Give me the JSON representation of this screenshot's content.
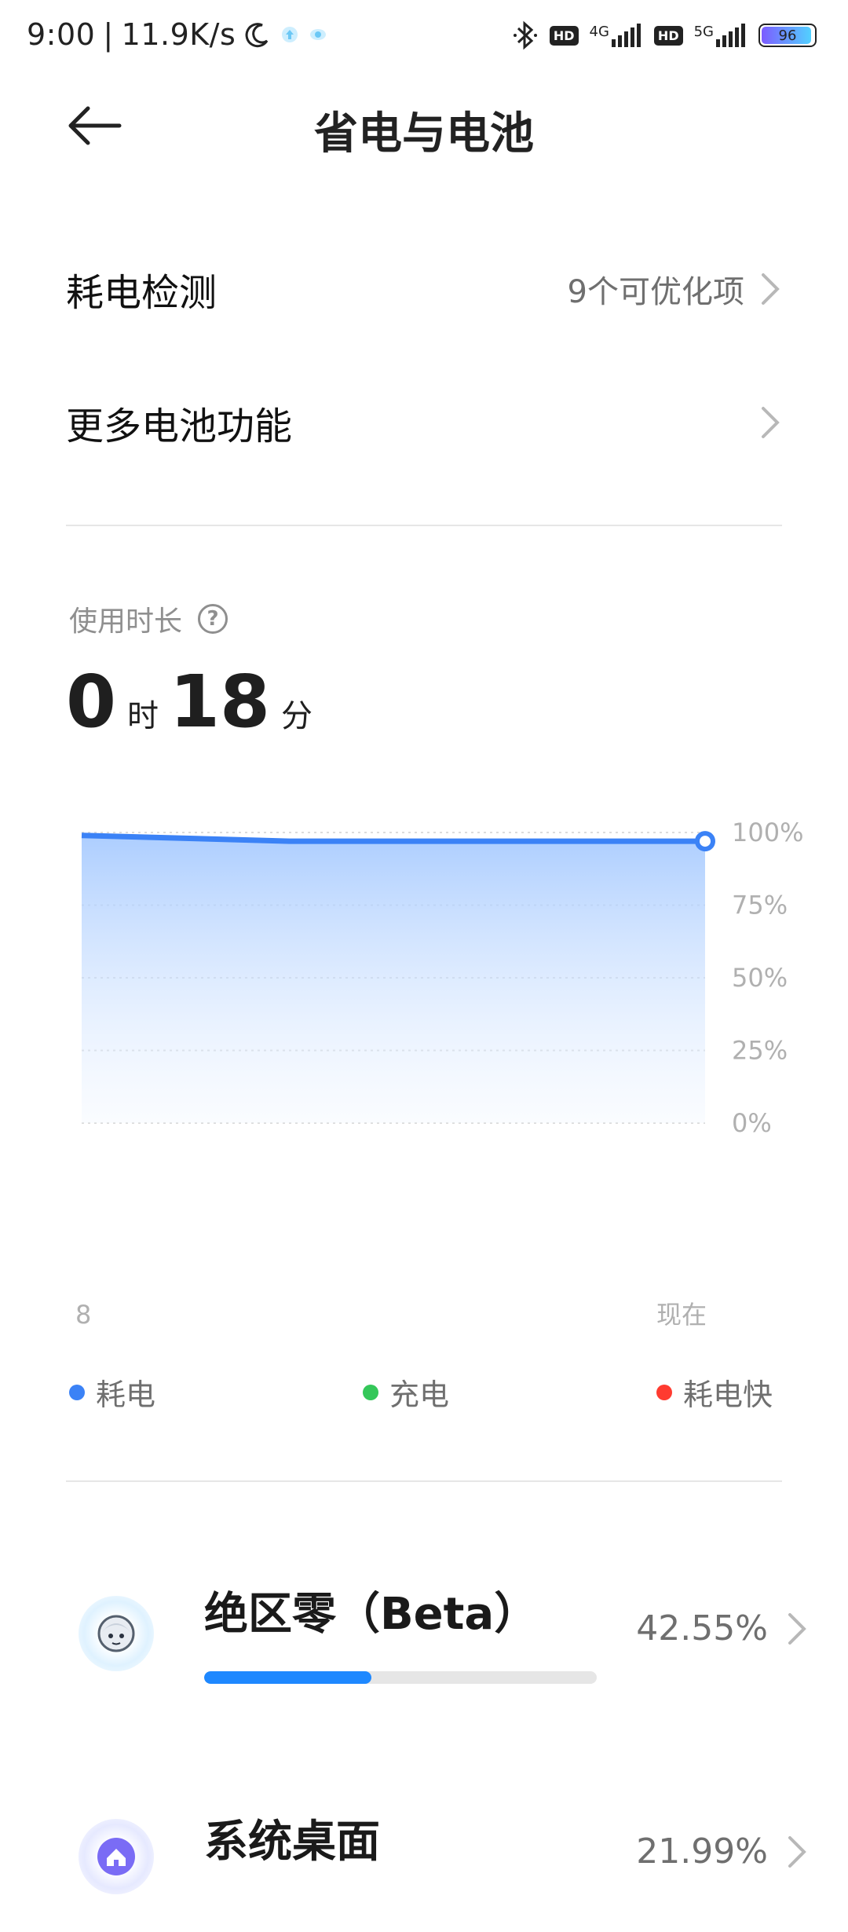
{
  "status_bar": {
    "time": "9:00",
    "net_speed": "11.9K/s",
    "hd1": "HD",
    "net1": "4G",
    "hd2": "HD",
    "net2": "5G",
    "battery": "96",
    "battery_level": 0.96
  },
  "header": {
    "title": "省电与电池"
  },
  "rows": [
    {
      "label": "耗电检测",
      "value": "9个可优化项"
    },
    {
      "label": "更多电池功能",
      "value": ""
    }
  ],
  "usage": {
    "label": "使用时长",
    "hours": "0",
    "hours_unit": "时",
    "minutes": "18",
    "minutes_unit": "分"
  },
  "chart_data": {
    "type": "area",
    "x_start_label": "8",
    "x_end_label": "现在",
    "y_ticks": [
      "100%",
      "75%",
      "50%",
      "25%",
      "0%"
    ],
    "ylim": [
      0,
      100
    ],
    "values": [
      99,
      98,
      97,
      97,
      97,
      97,
      97
    ]
  },
  "legend": [
    {
      "label": "耗电",
      "color": "#3b82f6"
    },
    {
      "label": "充电",
      "color": "#34c759"
    },
    {
      "label": "耗电快",
      "color": "#ff3b30"
    }
  ],
  "apps": [
    {
      "name": "绝区零（Beta）",
      "percent": "42.55%",
      "share": 0.4255,
      "icon": "game-character-icon"
    },
    {
      "name": "系统桌面",
      "percent": "21.99%",
      "share": 0.2199,
      "icon": "home-icon"
    }
  ],
  "colors": {
    "accent": "#1e88ff"
  }
}
